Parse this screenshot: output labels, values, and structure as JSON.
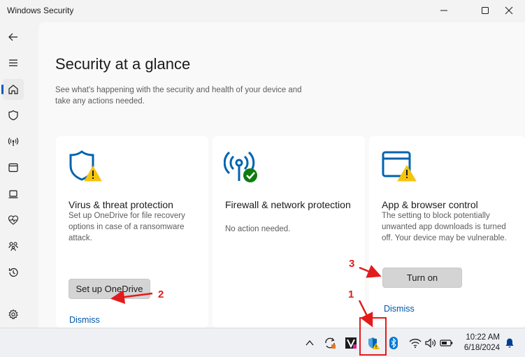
{
  "window": {
    "title": "Windows Security",
    "controls": [
      "minimize-icon",
      "maximize-icon",
      "close-icon"
    ]
  },
  "sidebar": {
    "icons": [
      "back-arrow-icon",
      "hamburger-menu-icon",
      "home-icon",
      "shield-icon",
      "network-antenna-icon",
      "app-browser-icon",
      "device-laptop-icon",
      "health-heart-icon",
      "family-icon",
      "history-icon",
      "settings-gear-icon"
    ],
    "active": "home-icon"
  },
  "main": {
    "heading": "Security at a glance",
    "subtitle": "See what's happening with the security and health of your device and take any actions needed."
  },
  "cards": [
    {
      "icon": "shield-warning-icon",
      "title": "Virus & threat protection",
      "description": "Set up OneDrive for file recovery options in case of a ransomware attack.",
      "button": "Set up OneDrive",
      "link": "Dismiss",
      "status": "warning"
    },
    {
      "icon": "antenna-check-icon",
      "title": "Firewall & network protection",
      "description": "No action needed.",
      "status": "ok"
    },
    {
      "icon": "browser-window-warning-icon",
      "title": "App & browser control",
      "description": "The setting to block potentially unwanted app downloads is turned off. Your device may be vulnerable.",
      "button": "Turn on",
      "link": "Dismiss",
      "status": "warning"
    }
  ],
  "annotations": [
    "1",
    "2",
    "3"
  ],
  "taskbar": {
    "tray_icons": [
      "chevron-up-icon",
      "onedrive-sync-icon",
      "app-v-icon",
      "security-shield-warning-icon",
      "bluetooth-icon",
      "wifi-icon",
      "volume-icon",
      "battery-icon",
      "notification-bell-icon"
    ],
    "time": "10:22 AM",
    "date": "6/18/2024"
  },
  "colors": {
    "accent_blue": "#0063b1",
    "warning_yellow": "#f6c40e",
    "ok_green": "#107c10",
    "annotation_red": "#e31b1b",
    "link_blue": "#0057a8"
  }
}
